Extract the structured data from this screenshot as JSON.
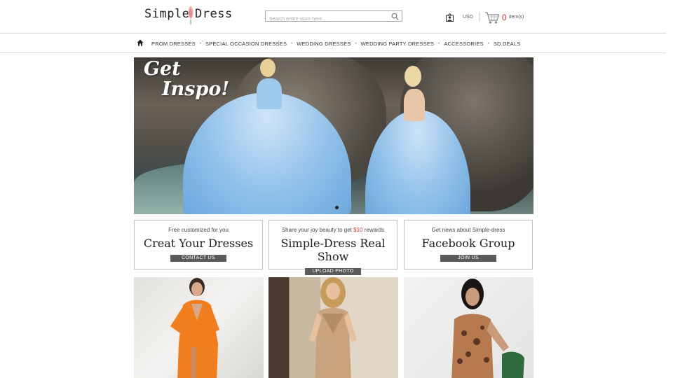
{
  "header": {
    "logo": {
      "word1": "Simple",
      "word2": "Dress"
    },
    "search": {
      "placeholder": "Search entire store here..."
    },
    "currency": "USD",
    "cart": {
      "count": "0",
      "label": "item(s)"
    }
  },
  "nav": {
    "items": [
      {
        "label": "PROM DRESSES"
      },
      {
        "label": "SPECIAL OCCASION DRESSES"
      },
      {
        "label": "WEDDING DRESSES"
      },
      {
        "label": "WEDDING PARTY DRESSES"
      },
      {
        "label": "ACCESSORIES"
      },
      {
        "label": "SD.DEALS"
      }
    ],
    "separator": "•"
  },
  "banner": {
    "headline_line1": "Get",
    "headline_line2": "Inspo!",
    "active_slide": 1
  },
  "promos": [
    {
      "subtitle": "Free customized for you",
      "title": "Creat Your Dresses",
      "button": "CONTACT US"
    },
    {
      "subtitle_pre": "Share your joy beauty to get ",
      "subtitle_highlight": "$10",
      "subtitle_post": " rewards",
      "title": "Simple-Dress Real Show",
      "button": "UPLOAD PHOTO"
    },
    {
      "subtitle": "Get news about Simple-dress",
      "title": "Facebook Group",
      "button": "JOIN US"
    }
  ],
  "colors": {
    "accent_red": "#d12f2f",
    "button_gray": "#5a5a5a",
    "border": "#bdbdbd"
  },
  "icons": [
    "home-icon",
    "search-icon",
    "account-icon",
    "cart-icon",
    "flower-icon"
  ]
}
